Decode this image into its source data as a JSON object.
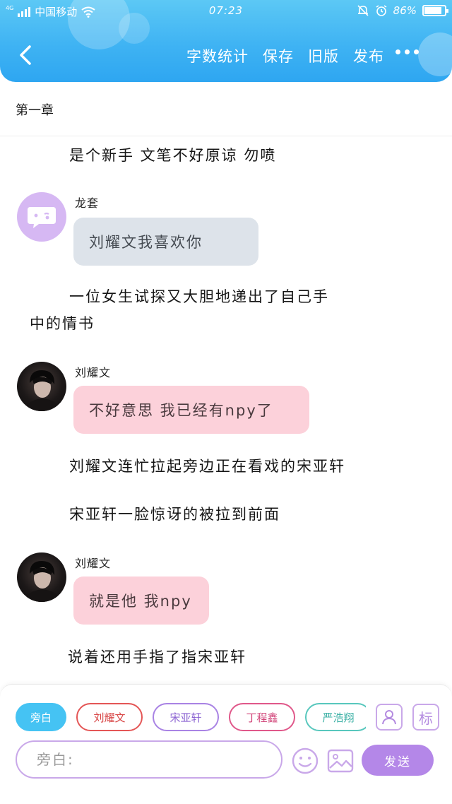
{
  "status_bar": {
    "network_tag": "4G",
    "carrier": "中国移动",
    "time": "07:23",
    "battery": "86%"
  },
  "header": {
    "toolbar": [
      "字数统计",
      "保存",
      "旧版",
      "发布"
    ]
  },
  "chapter": {
    "title": "第一章"
  },
  "story": {
    "narration_1": "是个新手 文笔不好原谅 勿喷",
    "message_1": {
      "speaker": "龙套",
      "text": "刘耀文我喜欢你"
    },
    "narration_2a": "一位女生试探又大胆地递出了自己手",
    "narration_2b": "中的情书",
    "message_2": {
      "speaker": "刘耀文",
      "text": "不好意思 我已经有npy了"
    },
    "narration_3": "刘耀文连忙拉起旁边正在看戏的宋亚轩",
    "narration_4": "宋亚轩一脸惊讶的被拉到前面",
    "message_3": {
      "speaker": "刘耀文",
      "text": "就是他 我npy"
    },
    "narration_5": "说着还用手指了指宋亚轩"
  },
  "roles": [
    "旁白",
    "刘耀文",
    "宋亚轩",
    "丁程鑫",
    "严浩翔"
  ],
  "tools": {
    "tag_label": "标"
  },
  "input": {
    "placeholder": "旁白:",
    "value": ""
  },
  "send_label": "发送",
  "colors": {
    "header": "#3fb3f3",
    "accent_purple": "#b487e8",
    "bubble_gray": "#dde3ea",
    "bubble_pink": "#fcd1da",
    "active_role": "#45c3f3"
  }
}
